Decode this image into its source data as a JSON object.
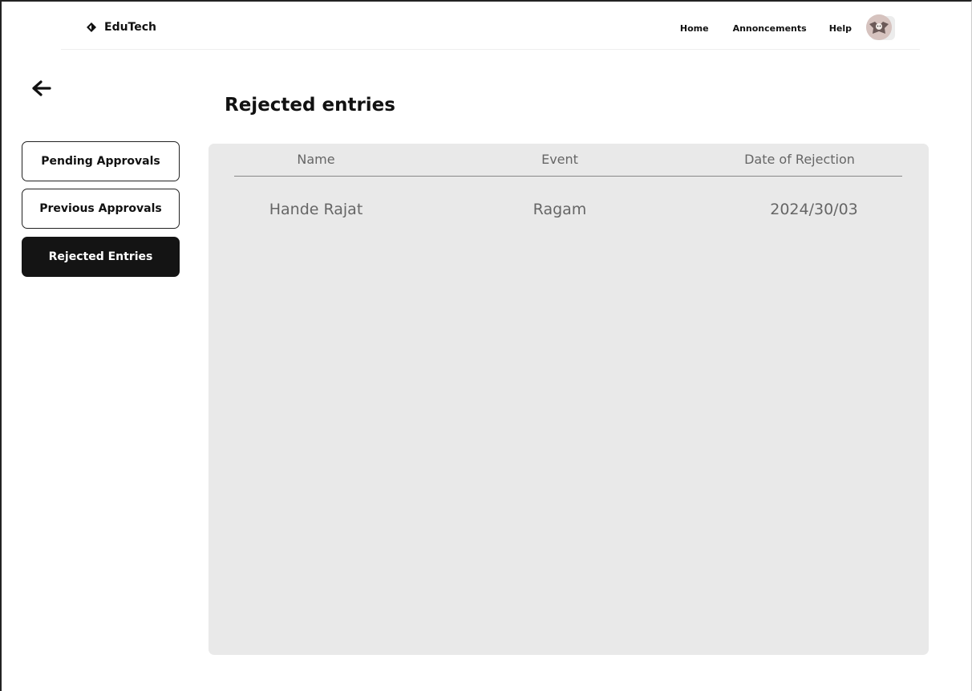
{
  "header": {
    "brand": "EduTech",
    "nav": [
      "Home",
      "Annoncements",
      "Help"
    ],
    "icons": {
      "brand": "diamond-logo-icon",
      "notifications": "bell-icon",
      "back": "arrow-left-icon"
    }
  },
  "page": {
    "title": "Rejected entries"
  },
  "sidebar": {
    "items": [
      {
        "label": "Pending Approvals",
        "active": false
      },
      {
        "label": "Previous Approvals",
        "active": false
      },
      {
        "label": "Rejected Entries",
        "active": true
      }
    ]
  },
  "table": {
    "columns": [
      "Name",
      "Event",
      "Date of Rejection"
    ],
    "rows": [
      {
        "name": "Hande Rajat",
        "event": "Ragam",
        "date": "2024/30/03"
      }
    ]
  },
  "colors": {
    "accent": "#141414",
    "panel": "#e9e9e9",
    "text_muted": "#666666"
  }
}
